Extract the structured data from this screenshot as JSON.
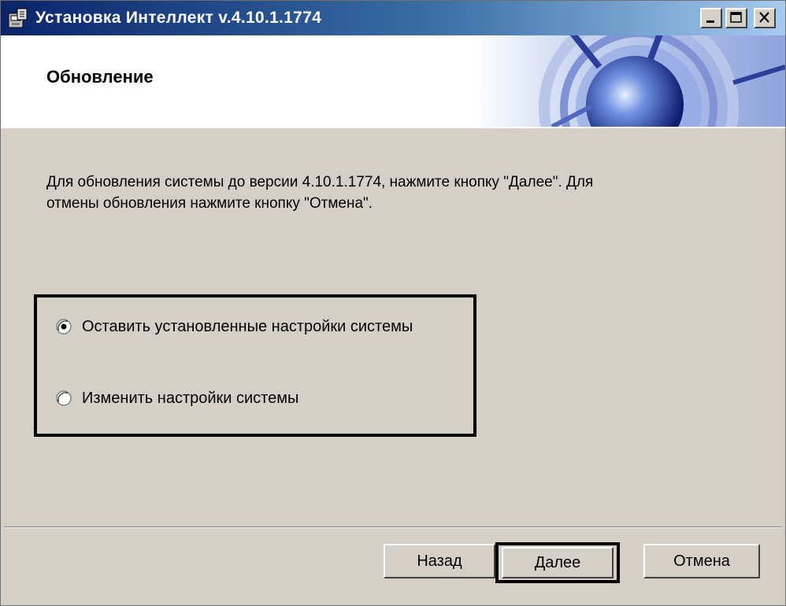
{
  "window": {
    "title": "Установка Интеллект v.4.10.1.1774",
    "app_icon": "installer-icon",
    "controls": [
      "minimize-icon",
      "maximize-icon",
      "close-icon"
    ]
  },
  "header": {
    "title": "Обновление"
  },
  "description": {
    "line1": "Для обновления системы до версии 4.10.1.1774, нажмите кнопку \"Далее\". Для",
    "line2": "отмены обновления нажмите кнопку \"Отмена\"."
  },
  "options": [
    {
      "label": "Оставить установленные настройки системы",
      "selected": true
    },
    {
      "label": "Изменить настройки системы",
      "selected": false
    }
  ],
  "buttons": {
    "back": "Назад",
    "next": "Далее",
    "cancel": "Отмена"
  }
}
